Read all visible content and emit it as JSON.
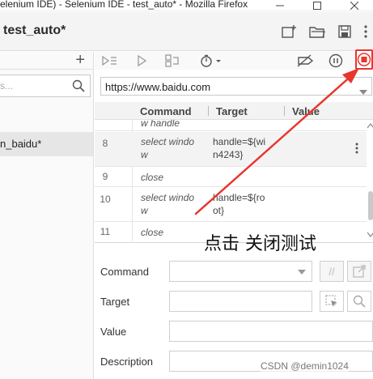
{
  "window": {
    "title": "elenium IDE) - Selenium IDE - test_auto* - Mozilla Firefox",
    "controls": [
      "minimize",
      "maximize",
      "close"
    ]
  },
  "header": {
    "project_title": "test_auto*",
    "icons": [
      "new-project-icon",
      "open-project-icon",
      "save-project-icon",
      "more-icon"
    ]
  },
  "sidebar": {
    "add_label": "+",
    "search_placeholder": "s...",
    "test_name": "n_baidu*"
  },
  "toolbar": {
    "icons": [
      "run-all-icon",
      "run-current-icon",
      "step-icon",
      "speed-icon",
      "disable-breakpoints-icon",
      "pause-icon",
      "stop-recording-icon"
    ],
    "stop_color": "#e8352e"
  },
  "url_bar": {
    "value": "https://www.baidu.com"
  },
  "table": {
    "headers": {
      "command": "Command",
      "target": "Target",
      "value": "Value"
    },
    "partial_row": {
      "command": "w handle"
    },
    "rows": [
      {
        "num": "8",
        "command_l1": "select windo",
        "command_l2": "w",
        "target_l1": "handle=${wi",
        "target_l2": "n4243}"
      },
      {
        "num": "9",
        "command_l1": "close",
        "command_l2": "",
        "target_l1": "",
        "target_l2": ""
      },
      {
        "num": "10",
        "command_l1": "select windo",
        "command_l2": "w",
        "target_l1": "handle=${ro",
        "target_l2": "ot}"
      },
      {
        "num": "11",
        "command_l1": "close",
        "command_l2": "",
        "target_l1": "",
        "target_l2": ""
      }
    ]
  },
  "form": {
    "command_label": "Command",
    "target_label": "Target",
    "value_label": "Value",
    "description_label": "Description",
    "comment_toggle": "//"
  },
  "annotation": {
    "text": "点击 关闭测试",
    "arrow_color": "#e8352e"
  },
  "watermark": "CSDN @demin1024"
}
